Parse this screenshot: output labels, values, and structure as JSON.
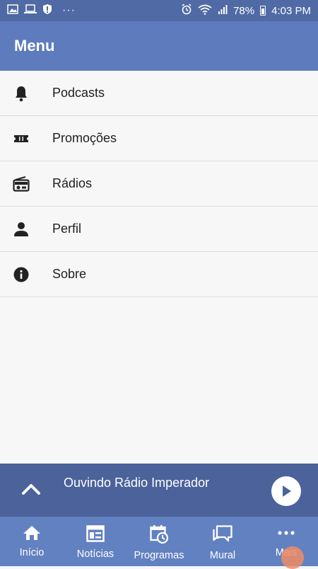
{
  "status_bar": {
    "battery": "78%",
    "time": "4:03 PM",
    "dots": "···"
  },
  "app_bar": {
    "title": "Menu"
  },
  "menu": {
    "items": [
      {
        "label": "Podcasts",
        "icon": "bell-icon"
      },
      {
        "label": "Promoções",
        "icon": "ticket-icon"
      },
      {
        "label": "Rádios",
        "icon": "radio-icon"
      },
      {
        "label": "Perfil",
        "icon": "person-icon"
      },
      {
        "label": "Sobre",
        "icon": "info-icon"
      }
    ]
  },
  "player": {
    "now_playing": "Ouvindo Rádio Imperador"
  },
  "bottom_nav": {
    "items": [
      {
        "label": "Início",
        "icon": "home-icon"
      },
      {
        "label": "Notícias",
        "icon": "news-icon"
      },
      {
        "label": "Programas",
        "icon": "calendar-clock-icon"
      },
      {
        "label": "Mural",
        "icon": "chat-icon"
      },
      {
        "label": "Mais",
        "icon": "more-icon"
      }
    ]
  },
  "colors": {
    "status_bar": "#4f6aa4",
    "app_bar": "#5e7bbd",
    "player": "#4b629b",
    "bottom_nav": "#6281c1",
    "background": "#f7f7f7"
  }
}
